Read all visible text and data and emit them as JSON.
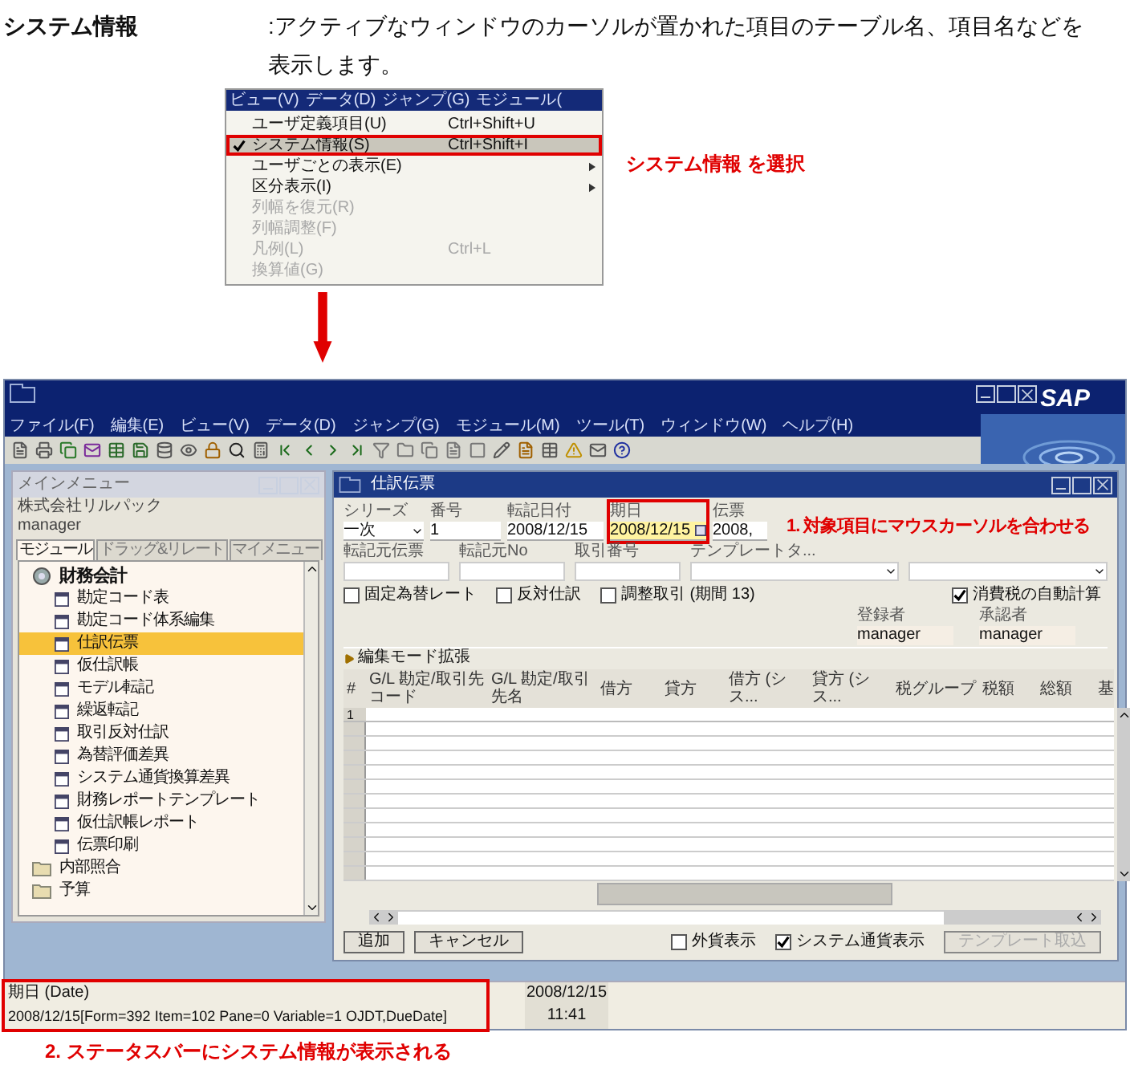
{
  "heading": {
    "label": "システム情報",
    "description": ":アクティブなウィンドウのカーソルが置かれた項目のテーブル名、項目名などを表示します。"
  },
  "menu_example": {
    "menubar": [
      "ビュー(V)",
      "データ(D)",
      "ジャンプ(G)",
      "モジュール("
    ],
    "items": [
      {
        "label": "ユーザ定義項目(U)",
        "shortcut": "Ctrl+Shift+U",
        "checked": false,
        "disabled": false,
        "submenu": false,
        "selected": false
      },
      {
        "label": "システム情報(S)",
        "shortcut": "Ctrl+Shift+I",
        "checked": true,
        "disabled": false,
        "submenu": false,
        "selected": true
      },
      {
        "label": "ユーザごとの表示(E)",
        "checked": false,
        "disabled": false,
        "submenu": true,
        "selected": false
      },
      {
        "label": "区分表示(I)",
        "checked": false,
        "disabled": false,
        "submenu": true,
        "selected": false
      },
      {
        "label": "列幅を復元(R)",
        "checked": false,
        "disabled": true,
        "submenu": false,
        "selected": false
      },
      {
        "label": "列幅調整(F)",
        "checked": false,
        "disabled": true,
        "submenu": false,
        "selected": false
      },
      {
        "label": "凡例(L)",
        "shortcut": "Ctrl+L",
        "checked": false,
        "disabled": true,
        "submenu": false,
        "selected": false
      },
      {
        "label": "換算値(G)",
        "checked": false,
        "disabled": true,
        "submenu": false,
        "selected": false
      }
    ],
    "callout": "システム情報 を選択"
  },
  "app": {
    "menubar": [
      "ファイル(F)",
      "編集(E)",
      "ビュー(V)",
      "データ(D)",
      "ジャンプ(G)",
      "モジュール(M)",
      "ツール(T)",
      "ウィンドウ(W)",
      "ヘルプ(H)"
    ],
    "logo": "SAP"
  },
  "main_menu": {
    "title": "メインメニュー",
    "company": "株式会社リルパック",
    "user": "manager",
    "tabs": [
      {
        "label": "モジュール",
        "selected": true
      },
      {
        "label": "ドラッグ&リレート",
        "selected": false
      },
      {
        "label": "マイメニュー",
        "selected": false
      }
    ],
    "tree": [
      {
        "label": "財務会計",
        "kind": "module",
        "selected": false,
        "children": [
          {
            "label": "勘定コード表",
            "kind": "form",
            "selected": false
          },
          {
            "label": "勘定コード体系編集",
            "kind": "form",
            "selected": false
          },
          {
            "label": "仕訳伝票",
            "kind": "form",
            "selected": true
          },
          {
            "label": "仮仕訳帳",
            "kind": "form",
            "selected": false
          },
          {
            "label": "モデル転記",
            "kind": "form",
            "selected": false
          },
          {
            "label": "繰返転記",
            "kind": "form",
            "selected": false
          },
          {
            "label": "取引反対仕訳",
            "kind": "form",
            "selected": false
          },
          {
            "label": "為替評価差異",
            "kind": "form",
            "selected": false
          },
          {
            "label": "システム通貨換算差異",
            "kind": "form",
            "selected": false
          },
          {
            "label": "財務レポートテンプレート",
            "kind": "form",
            "selected": false
          },
          {
            "label": "仮仕訳帳レポート",
            "kind": "form",
            "selected": false
          },
          {
            "label": "伝票印刷",
            "kind": "form",
            "selected": false
          }
        ]
      },
      {
        "label": "内部照合",
        "kind": "folder",
        "selected": false
      },
      {
        "label": "予算",
        "kind": "folder",
        "selected": false
      }
    ]
  },
  "journal": {
    "title": "仕訳伝票",
    "fields": [
      {
        "label": "シリーズ",
        "value": "一次",
        "kind": "dropdown",
        "highlighted": false
      },
      {
        "label": "番号",
        "value": "1",
        "kind": "text",
        "highlighted": false
      },
      {
        "label": "転記日付",
        "value": "2008/12/15",
        "kind": "text",
        "highlighted": false
      },
      {
        "label": "期日",
        "value": "2008/12/15",
        "kind": "date",
        "highlighted": true
      },
      {
        "label": "伝票",
        "value": "2008,",
        "kind": "text",
        "highlighted": false
      }
    ],
    "callout": "1. 対象項目にマウスカーソルを合わせる",
    "fields_2": [
      {
        "label": "転記元伝票",
        "kind": "text"
      },
      {
        "label": "転記元No",
        "kind": "text"
      },
      {
        "label": "取引番号",
        "kind": "text"
      },
      {
        "label": "テンプレートタ...",
        "kind": "dropdown"
      }
    ],
    "options": [
      {
        "label": "固定為替レート",
        "checked": false
      },
      {
        "label": "反対仕訳",
        "checked": false
      },
      {
        "label": "調整取引 (期間 13)",
        "checked": false
      },
      {
        "label": "消費税の自動計算",
        "checked": true
      }
    ],
    "people": [
      {
        "label": "登録者",
        "value": "manager"
      },
      {
        "label": "承認者",
        "value": "manager"
      }
    ],
    "edit_mode": "編集モード拡張",
    "table": {
      "columns": [
        "#",
        "G/L 勘定/取引先コード",
        "G/L 勘定/取引先名",
        "借方",
        "貸方",
        "借方 (シス...",
        "貸方 (シス...",
        "税グループ",
        "税額",
        "総額",
        "基"
      ],
      "rows": [
        {
          "number": "1"
        }
      ]
    },
    "buttons": [
      {
        "label": "追加",
        "disabled": false
      },
      {
        "label": "キャンセル",
        "disabled": false
      }
    ],
    "bottom_options": [
      {
        "label": "外貨表示",
        "checked": false
      },
      {
        "label": "システム通貨表示",
        "checked": true
      }
    ],
    "template_button": {
      "label": "テンプレート取込",
      "disabled": true
    }
  },
  "status_bar": {
    "highlighted": true,
    "field": "期日 (Date)",
    "info": "2008/12/15[Form=392 Item=102 Pane=0 Variable=1 OJDT,DueDate]",
    "date": "2008/12/15",
    "time": "11:41"
  },
  "callout_2": "2. ステータスバーにシステム情報が表示される"
}
